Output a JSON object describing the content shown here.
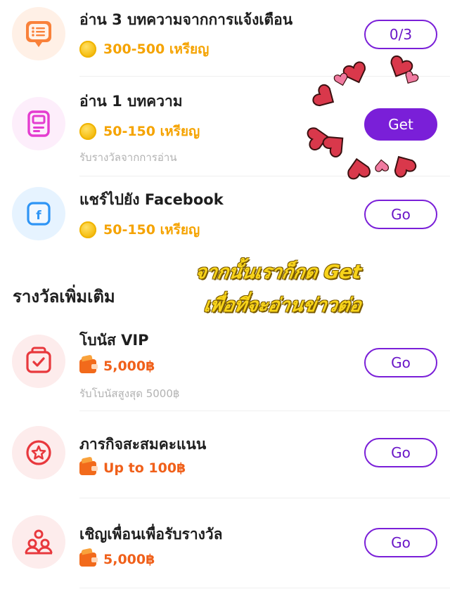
{
  "tasks": [
    {
      "title": "อ่าน 3 บทความจากการแจ้งเตือน",
      "reward": "300-500 เหรียญ",
      "sub": "",
      "button": "0/3"
    },
    {
      "title": "อ่าน 1 บทความ",
      "reward": "50-150 เหรียญ",
      "sub": "รับรางวัลจากการอ่าน",
      "button": "Get"
    },
    {
      "title": "แชร์ไปยัง Facebook",
      "reward": "50-150 เหรียญ",
      "sub": "",
      "button": "Go"
    }
  ],
  "section_title": "รางวัลเพิ่มเติม",
  "bonus": [
    {
      "title": "โบนัส VIP",
      "reward": "5,000฿",
      "sub": "รับโบนัสสูงสุด 5000฿",
      "button": "Go"
    },
    {
      "title": "ภารกิจสะสมคะแนน",
      "reward": "Up to 100฿",
      "sub": "",
      "button": "Go"
    },
    {
      "title": "เชิญเพื่อนเพื่อรับรางวัล",
      "reward": "5,000฿",
      "sub": "",
      "button": "Go"
    }
  ],
  "overlay": {
    "line1": "จากนั้นเราก็กด Get",
    "line2": "เพื่อที่จะอ่านข่าวต่อ"
  },
  "icons": {
    "task1": "message-list-icon",
    "task2": "article-icon",
    "task3": "facebook-icon",
    "bonus1": "calendar-check-icon",
    "bonus2": "star-badge-icon",
    "bonus3": "invite-people-icon",
    "reward_coin": "coin-icon",
    "reward_cash": "wallet-icon"
  },
  "colors": {
    "accent": "#7a1fd8",
    "coin": "#f5a300",
    "cash": "#f0601a",
    "overlay": "#f8d41a"
  }
}
